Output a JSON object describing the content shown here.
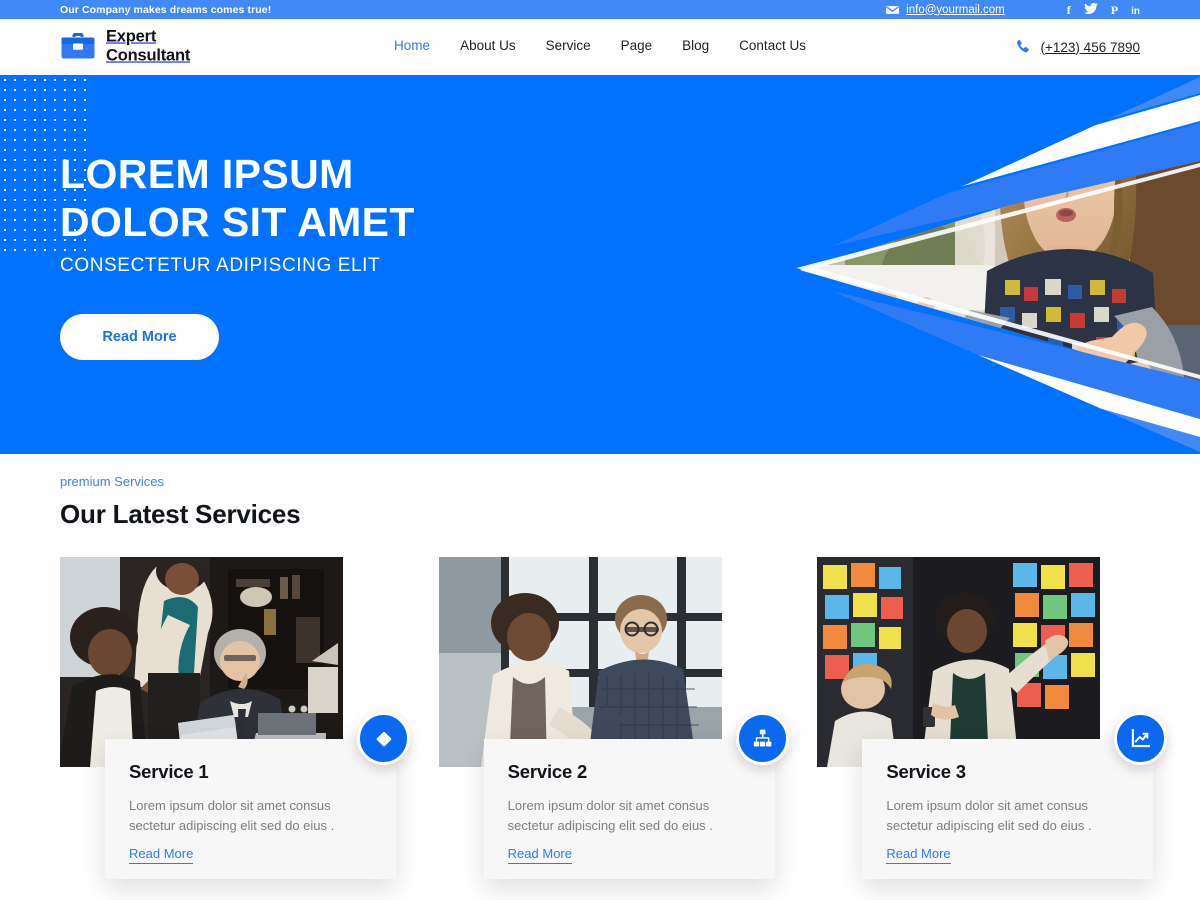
{
  "topbar": {
    "tagline": "Our Company makes dreams comes true!",
    "email": "info@yourmail.com",
    "email_icon": "envelope-icon",
    "social": [
      {
        "name": "facebook",
        "glyph": "f"
      },
      {
        "name": "twitter",
        "glyph": ""
      },
      {
        "name": "pinterest",
        "glyph": "P"
      },
      {
        "name": "linkedin",
        "glyph": "in"
      }
    ],
    "bg_color": "#4089f7"
  },
  "header": {
    "logo_line1": "Expert",
    "logo_line2": "Consultant",
    "logo_icon": "briefcase-icon",
    "phone": "(+123) 456 7890",
    "phone_icon": "phone-icon",
    "nav": [
      {
        "label": "Home",
        "active": true
      },
      {
        "label": "About Us",
        "active": false
      },
      {
        "label": "Service",
        "active": false
      },
      {
        "label": "Page",
        "active": false
      },
      {
        "label": "Blog",
        "active": false
      },
      {
        "label": "Contact Us",
        "active": false
      }
    ]
  },
  "hero": {
    "title_line1": "LOREM IPSUM",
    "title_line2": "DOLOR SIT AMET",
    "subtitle": "CONSECTETUR ADIPISCING ELIT",
    "button_label": "Read More",
    "bg_color": "#0072ff",
    "accent_color": "#4089f7"
  },
  "services": {
    "eyebrow": "premium Services",
    "heading": "Our Latest Services",
    "cards": [
      {
        "title": "Service 1",
        "desc": "Lorem ipsum dolor sit amet consus sectetur adipiscing elit sed do eius .",
        "link_label": "Read More",
        "icon": "diamond-icon",
        "photo_alt": "three colleagues reviewing documents at an office desk"
      },
      {
        "title": "Service 2",
        "desc": "Lorem ipsum dolor sit amet consus sectetur adipiscing elit sed do eius .",
        "link_label": "Read More",
        "icon": "sitemap-icon",
        "photo_alt": "two coworkers talking by a large office window"
      },
      {
        "title": "Service 3",
        "desc": "Lorem ipsum dolor sit amet consus sectetur adipiscing elit sed do eius .",
        "link_label": "Read More",
        "icon": "chart-line-icon",
        "photo_alt": "team at a wall of colorful sticky notes"
      }
    ],
    "badge_color": "#0b69ef",
    "link_color": "#2f7bf6"
  }
}
